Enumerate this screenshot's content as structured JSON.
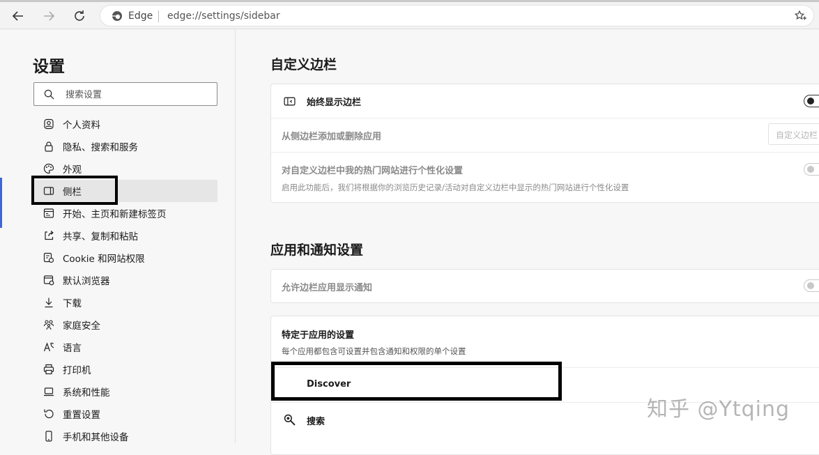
{
  "browser": {
    "brand": "Edge",
    "url": "edge://settings/sidebar"
  },
  "sidebar": {
    "title": "设置",
    "search_placeholder": "搜索设置",
    "items": [
      {
        "label": "个人资料",
        "icon": "profile-icon"
      },
      {
        "label": "隐私、搜索和服务",
        "icon": "lock-icon"
      },
      {
        "label": "外观",
        "icon": "palette-icon"
      },
      {
        "label": "侧栏",
        "icon": "sidebar-icon",
        "active": true
      },
      {
        "label": "开始、主页和新建标签页",
        "icon": "home-icon"
      },
      {
        "label": "共享、复制和粘贴",
        "icon": "share-icon"
      },
      {
        "label": "Cookie 和网站权限",
        "icon": "cookie-icon"
      },
      {
        "label": "默认浏览器",
        "icon": "browser-icon"
      },
      {
        "label": "下载",
        "icon": "download-icon"
      },
      {
        "label": "家庭安全",
        "icon": "family-icon"
      },
      {
        "label": "语言",
        "icon": "language-icon"
      },
      {
        "label": "打印机",
        "icon": "printer-icon"
      },
      {
        "label": "系统和性能",
        "icon": "laptop-icon"
      },
      {
        "label": "重置设置",
        "icon": "reset-icon"
      },
      {
        "label": "手机和其他设备",
        "icon": "phone-icon"
      }
    ]
  },
  "customize": {
    "title": "自定义边栏",
    "always_show": {
      "label": "始终显示边栏",
      "enabled": true
    },
    "add_remove": {
      "label": "从侧边栏添加或删除应用",
      "button": "自定义边栏"
    },
    "personalize": {
      "label": "对自定义边栏中我的热门网站进行个性化设置",
      "desc": "启用此功能后，我们将根据你的浏览历史记录/活动对自定义边栏中显示的热门网站进行个性化设置",
      "enabled": false
    }
  },
  "apps": {
    "title": "应用和通知设置",
    "allow_notifications": {
      "label": "允许边栏应用显示通知",
      "enabled": false
    },
    "app_specific": {
      "label": "特定于应用的设置",
      "desc": "每个应用都包含可设置并包含通知和权限的单个设置"
    },
    "app_list": [
      {
        "label": "Discover",
        "icon": "discover-icon"
      },
      {
        "label": "搜索",
        "icon": "search-icon"
      }
    ]
  },
  "watermark": "知乎 @Ytqing",
  "colors": {
    "accent_marker": "#3e66d6",
    "annotation_box": "#000000"
  }
}
